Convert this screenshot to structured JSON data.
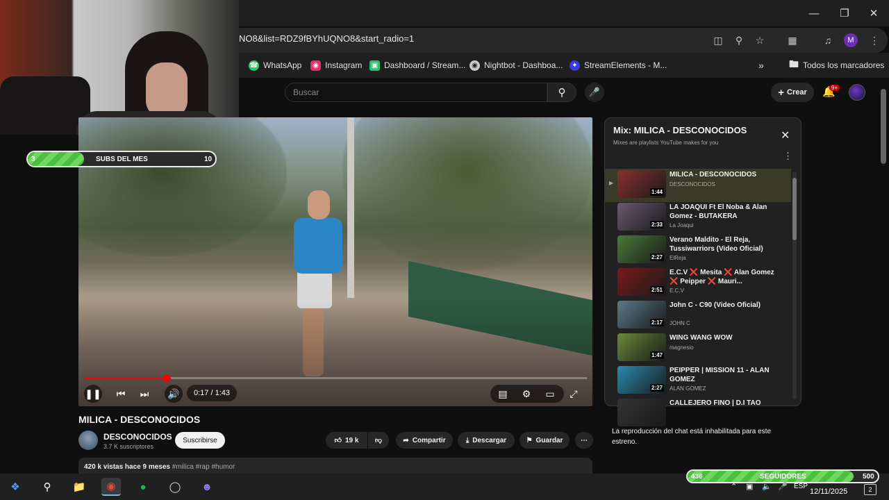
{
  "browser": {
    "url": "NO8&list=RDZ9fBYhUQNO8&start_radio=1",
    "bookmarks": [
      {
        "label": "WhatsApp",
        "icon": "whatsapp-icon",
        "color": "#25d366"
      },
      {
        "label": "Instagram",
        "icon": "instagram-icon",
        "color": "#e1306c"
      },
      {
        "label": "Dashboard / Stream...",
        "icon": "dashboard-icon",
        "color": "#2fbf71"
      },
      {
        "label": "Nightbot - Dashboa...",
        "icon": "nightbot-icon",
        "color": "#cccccc"
      },
      {
        "label": "StreamElements - M...",
        "icon": "streamelements-icon",
        "color": "#3b3bdb"
      }
    ],
    "all_bookmarks": "Todos los marcadores",
    "profile_letter": "M"
  },
  "youtube": {
    "search_placeholder": "Buscar",
    "create_label": "Crear",
    "notification_count": "9+"
  },
  "video": {
    "time": "0:17 / 1:43",
    "progress_fraction": 0.165,
    "title": "MILICA - DESCONOCIDOS",
    "channel": "DESCONOCIDOS",
    "subscribers": "3.7 K suscriptores",
    "subscribe_label": "Suscribirse",
    "likes": "19 k",
    "share_label": "Compartir",
    "download_label": "Descargar",
    "save_label": "Guardar",
    "views_date": "420 k vistas  hace 9 meses",
    "hashtags": "#milica #rap #humor"
  },
  "overlay_subs": {
    "current": "3",
    "label": "SUBS DEL MES",
    "goal": "10",
    "fraction": 0.3
  },
  "overlay_followers": {
    "current": "436",
    "label": "SEGUIDORES",
    "goal": "500",
    "fraction": 0.872
  },
  "playlist": {
    "title": "Mix: MILICA - DESCONOCIDOS",
    "subtitle": "Mixes are playlists YouTube makes for you",
    "items": [
      {
        "title": "MILICA - DESCONOCIDOS",
        "channel": "DESCONOCIDOS",
        "duration": "1:44",
        "thumb": "#8a3030"
      },
      {
        "title": "LA JOAQUI Ft El Noba & Alan Gomez - BUTAKERA",
        "channel": "La Joaqui",
        "duration": "2:33",
        "thumb": "#6a5a70"
      },
      {
        "title": "Verano Maldito - El Reja, Tussiwarriors (Video Oficial)",
        "channel": "ElReja",
        "duration": "2:27",
        "thumb": "#4a7a3a"
      },
      {
        "title": "E.C.V ❌ Mesita ❌ Alan Gomez ❌ Peipper ❌ Mauri...",
        "channel": "E.C.V",
        "duration": "2:51",
        "thumb": "#7a1a1a"
      },
      {
        "title": "John C - C90 (Video Oficial)",
        "channel": "JOHN C",
        "duration": "2:17",
        "thumb": "#5a7a8a"
      },
      {
        "title": "WING WANG WOW",
        "channel": "magnesio",
        "duration": "1:47",
        "thumb": "#6a8a3a"
      },
      {
        "title": "PEIPPER | MISSION 11 - ALAN GOMEZ",
        "channel": "ALAN GOMEZ",
        "duration": "2:27",
        "thumb": "#2a8ab0"
      },
      {
        "title": "CALLEJERO FINO | D.I TAO",
        "channel": "",
        "duration": "",
        "thumb": "#333333"
      }
    ]
  },
  "chat_disabled": "La reproducción del chat está inhabilitada para este estreno.",
  "taskbar": {
    "language": "ESP",
    "date": "12/11/2025",
    "notifications": "2"
  }
}
